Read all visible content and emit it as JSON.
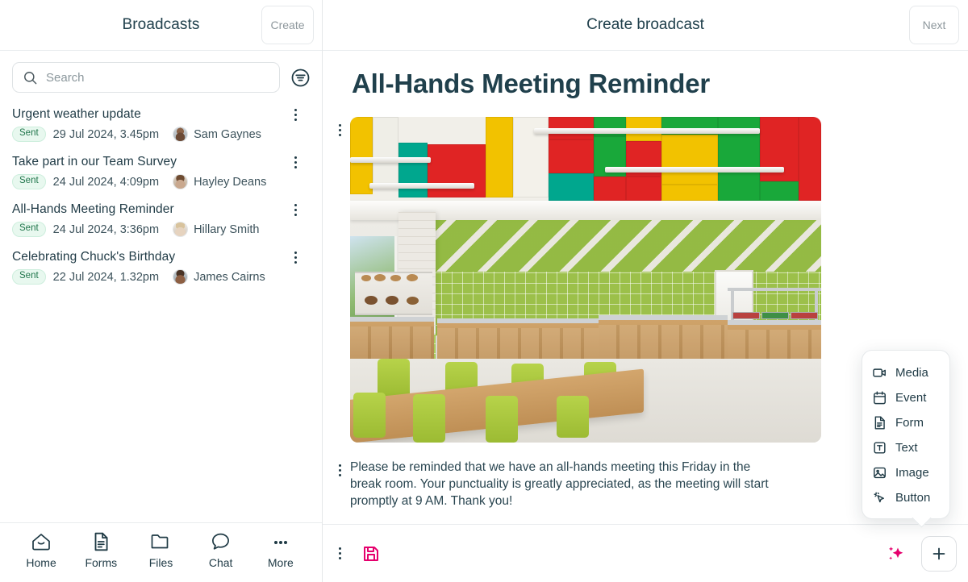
{
  "left": {
    "header": {
      "title": "Broadcasts",
      "create_label": "Create"
    },
    "search": {
      "placeholder": "Search",
      "value": "",
      "filter_icon": "filter-icon"
    },
    "broadcasts": [
      {
        "title": "Urgent weather update",
        "status": "Sent",
        "date": "29 Jul 2024, 3.45pm",
        "sender": "Sam Gaynes"
      },
      {
        "title": "Take part in our Team Survey",
        "status": "Sent",
        "date": "24 Jul 2024, 4:09pm",
        "sender": "Hayley Deans"
      },
      {
        "title": "All-Hands Meeting Reminder",
        "status": "Sent",
        "date": "24 Jul 2024, 3:36pm",
        "sender": "Hillary Smith"
      },
      {
        "title": "Celebrating Chuck's Birthday",
        "status": "Sent",
        "date": "22 Jul 2024, 1.32pm",
        "sender": "James Cairns"
      }
    ],
    "nav": [
      {
        "label": "Home",
        "icon": "home-icon"
      },
      {
        "label": "Forms",
        "icon": "document-icon"
      },
      {
        "label": "Files",
        "icon": "folder-icon"
      },
      {
        "label": "Chat",
        "icon": "chat-bubble-icon"
      },
      {
        "label": "More",
        "icon": "ellipsis-icon"
      }
    ]
  },
  "right": {
    "header": {
      "title": "Create broadcast",
      "next_label": "Next"
    },
    "document": {
      "title": "All-Hands Meeting Reminder",
      "image_alt": "Cafeteria break room with green chevron wall, serving counters and long wooden table",
      "paragraph": "Please be reminded that we have an all-hands meeting this Friday in the break room. Your punctuality is greatly appreciated, as the meeting will start promptly at 9 AM. Thank you!"
    },
    "bottom_bar": {
      "save_icon": "save-disk-icon",
      "ai_icon": "ai-sparkle-icon",
      "add_icon": "plus-icon"
    },
    "block_menu": [
      {
        "label": "Media",
        "icon": "video-camera-icon"
      },
      {
        "label": "Event",
        "icon": "calendar-icon"
      },
      {
        "label": "Form",
        "icon": "document-icon"
      },
      {
        "label": "Text",
        "icon": "text-box-icon"
      },
      {
        "label": "Image",
        "icon": "image-icon"
      },
      {
        "label": "Button",
        "icon": "cursor-sparkle-icon"
      }
    ]
  },
  "colors": {
    "ink": "#1f3a45",
    "muted": "#8d979c",
    "badge_text": "#21764c",
    "badge_bg": "#e8f8ef",
    "accent_pink": "#e5006d",
    "border": "#e6e9eb"
  }
}
